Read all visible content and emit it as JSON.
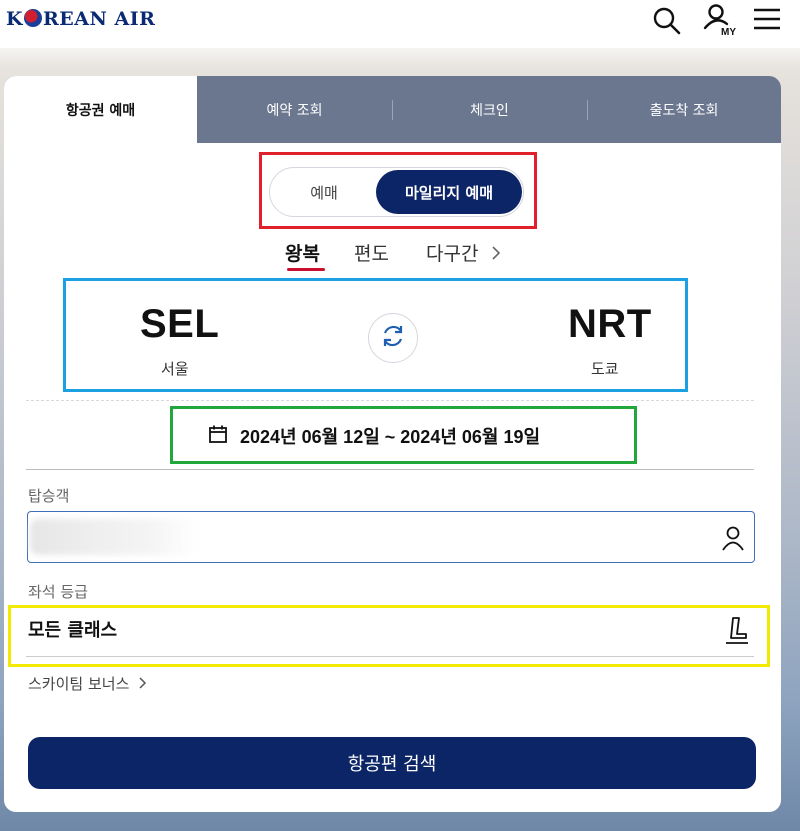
{
  "header": {
    "logo_text_pre": "K",
    "logo_text_post": "REAN AIR",
    "icons": [
      "search-icon",
      "my-account-icon",
      "menu-icon"
    ],
    "my_label": "MY"
  },
  "tabs": [
    {
      "label": "항공권 예매",
      "active": true
    },
    {
      "label": "예약 조회",
      "active": false
    },
    {
      "label": "체크인",
      "active": false
    },
    {
      "label": "출도착 조회",
      "active": false
    }
  ],
  "booking_toggle": {
    "options": [
      "예매",
      "마일리지 예매"
    ],
    "selected": "마일리지 예매"
  },
  "trip_types": {
    "round_trip": "왕복",
    "one_way": "편도",
    "multi_city": "다구간",
    "selected": "왕복"
  },
  "route": {
    "origin_code": "SEL",
    "origin_city": "서울",
    "destination_code": "NRT",
    "destination_city": "도쿄"
  },
  "dates": {
    "text": "2024년 06월 12일 ~ 2024년 06월 19일"
  },
  "passengers": {
    "label": "탑승객",
    "value": ""
  },
  "seat_class": {
    "label": "좌석 등급",
    "value": "모든 클래스"
  },
  "bonus": {
    "label": "스카이팀 보너스"
  },
  "search_button": {
    "label": "항공편 검색"
  },
  "colors": {
    "navy": "#0c2566",
    "tab_bg": "#6b778f",
    "accent_red": "#c8102e",
    "annotation_red": "#e0202b",
    "annotation_blue": "#1ba1e2",
    "annotation_green": "#22a83a",
    "annotation_yellow": "#f2ea00"
  }
}
